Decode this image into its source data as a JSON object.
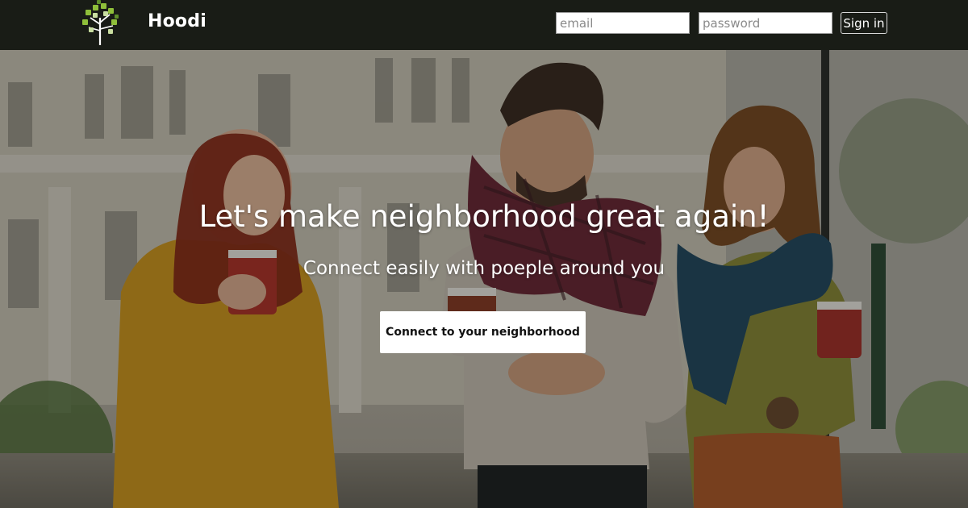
{
  "nav": {
    "brand": "Hoodi",
    "email_placeholder": "email",
    "password_placeholder": "password",
    "signin_label": "Sign in"
  },
  "hero": {
    "headline": "Let's make neighborhood great again!",
    "subheadline": "Connect easily with poeple around you",
    "cta_label": "Connect to your neighborhood"
  },
  "colors": {
    "navbar_bg": "#191c16",
    "logo_green": "#8fbf3a",
    "cta_bg": "#ffffff"
  },
  "icons": {
    "logo": "tree-logo-icon"
  }
}
